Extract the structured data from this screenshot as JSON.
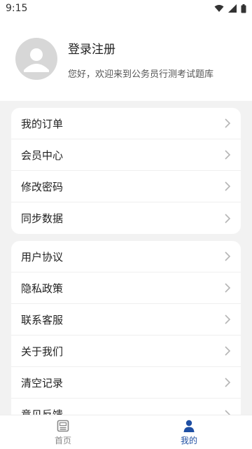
{
  "status": {
    "time": "9:15"
  },
  "profile": {
    "title": "登录注册",
    "subtitle": "您好，欢迎来到公务员行测考试题库"
  },
  "menu_group1": [
    {
      "label": "我的订单"
    },
    {
      "label": "会员中心"
    },
    {
      "label": "修改密码"
    },
    {
      "label": "同步数据"
    }
  ],
  "menu_group2": [
    {
      "label": "用户协议"
    },
    {
      "label": "隐私政策"
    },
    {
      "label": "联系客服"
    },
    {
      "label": "关于我们"
    },
    {
      "label": "清空记录"
    },
    {
      "label": "意见反馈"
    }
  ],
  "bottom_nav": [
    {
      "label": "首页",
      "icon": "home-icon",
      "active": false
    },
    {
      "label": "我的",
      "icon": "profile-icon",
      "active": true
    }
  ],
  "colors": {
    "accent": "#1f4fa3",
    "background": "#f2f2f2",
    "card": "#ffffff"
  }
}
